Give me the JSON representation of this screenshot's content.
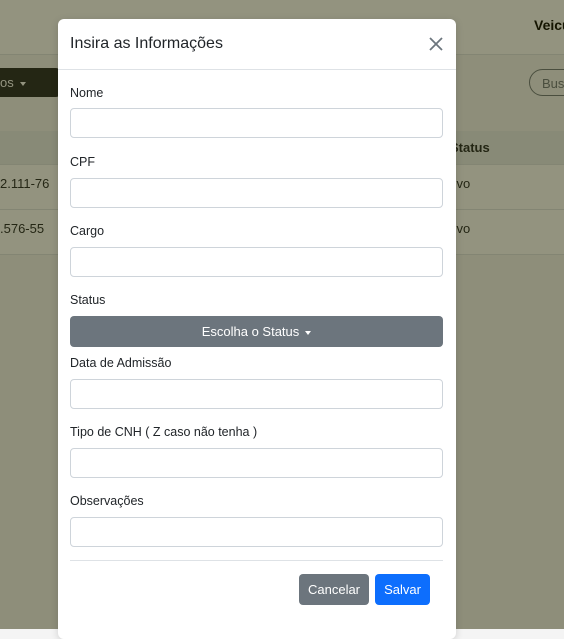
{
  "background": {
    "nav_text": "Veicu",
    "dropdown_label": "os",
    "search_placeholder": "Busc",
    "table": {
      "header_status": "Status",
      "rows": [
        {
          "left": "2.111-76",
          "status": "tivo"
        },
        {
          "left": ".576-55",
          "status": "tivo"
        }
      ]
    }
  },
  "modal": {
    "title": "Insira as Informações",
    "close_icon": "close-icon",
    "fields": {
      "nome": {
        "label": "Nome",
        "value": ""
      },
      "cpf": {
        "label": "CPF",
        "value": ""
      },
      "cargo": {
        "label": "Cargo",
        "value": ""
      },
      "status": {
        "label": "Status",
        "button": "Escolha o Status"
      },
      "admissao": {
        "label": "Data de Admissão",
        "value": ""
      },
      "cnh": {
        "label": "Tipo de CNH ( Z caso não tenha )",
        "value": ""
      },
      "obs": {
        "label": "Observações",
        "value": ""
      }
    },
    "buttons": {
      "cancel": "Cancelar",
      "save": "Salvar"
    }
  },
  "colors": {
    "primary": "#0d6efd",
    "secondary": "#6c757d",
    "backdrop": "rgba(40,40,0,0.5)"
  }
}
